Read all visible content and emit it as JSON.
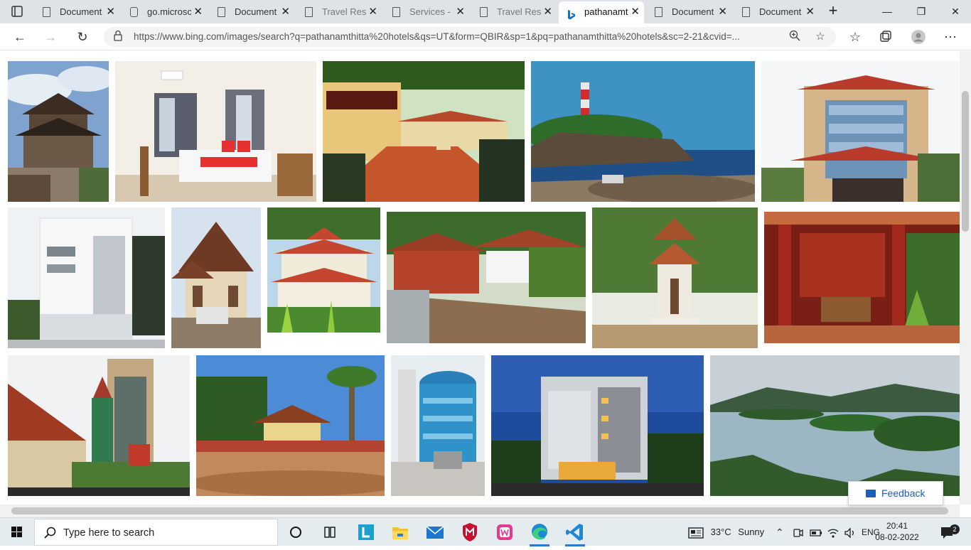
{
  "browser": {
    "tabs": [
      {
        "label": "Document",
        "icon": "document-icon",
        "active": false
      },
      {
        "label": "go.microsc",
        "icon": "link-icon",
        "active": false
      },
      {
        "label": "Document",
        "icon": "document-icon",
        "active": false
      },
      {
        "label": "Travel Resp",
        "icon": "document-icon",
        "active": false
      },
      {
        "label": "Services - ",
        "icon": "document-icon",
        "active": false
      },
      {
        "label": "Travel Resp",
        "icon": "document-icon",
        "active": false
      },
      {
        "label": "pathanamt",
        "icon": "bing-icon",
        "active": true
      },
      {
        "label": "Document",
        "icon": "document-icon",
        "active": false
      },
      {
        "label": "Document",
        "icon": "document-icon",
        "active": false
      }
    ],
    "url": "https://www.bing.com/images/search?q=pathanamthitta%20hotels&qs=UT&form=QBIR&sp=1&pq=pathanamthitta%20hotels&sc=2-21&cvid=..."
  },
  "feedback_label": "Feedback",
  "taskbar": {
    "search_placeholder": "Type here to search",
    "weather_temp": "33°C",
    "weather_text": "Sunny",
    "language": "ENG",
    "time": "20:41",
    "date": "08-02-2022",
    "notification_count": "2"
  }
}
